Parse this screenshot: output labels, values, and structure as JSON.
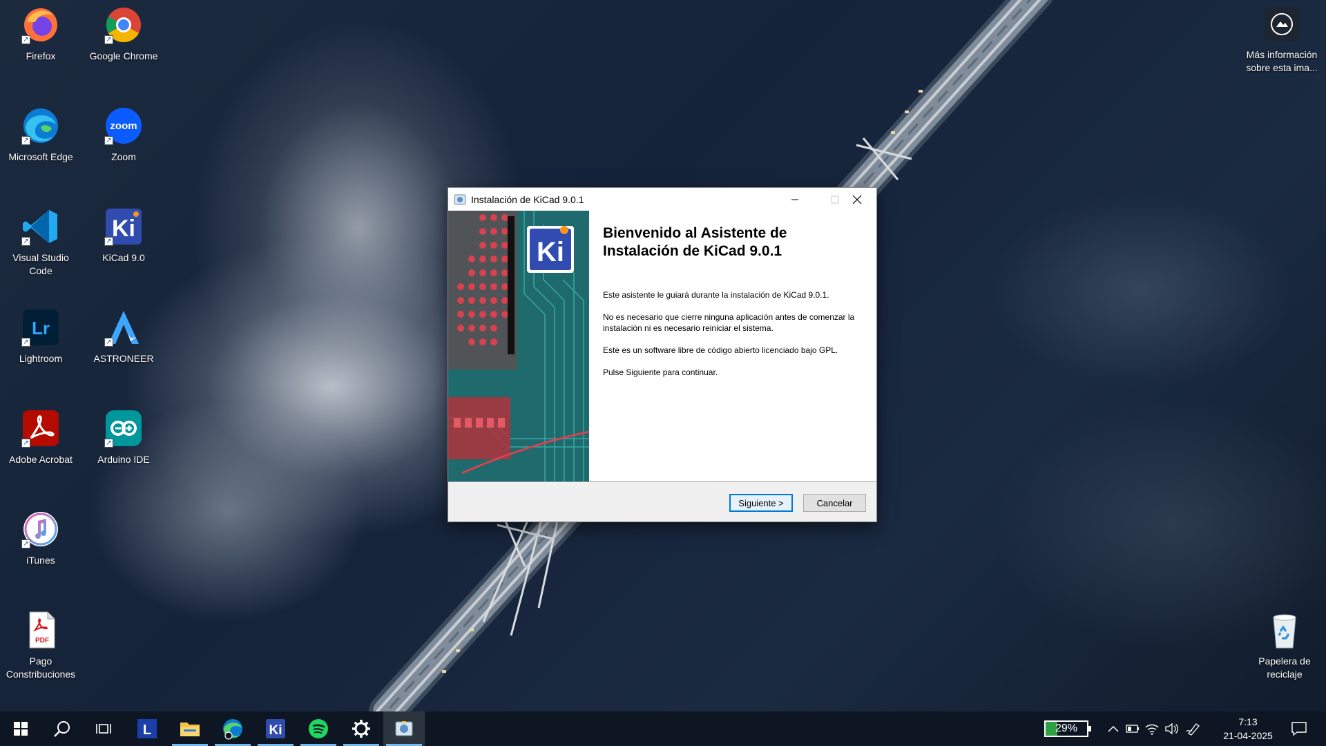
{
  "desktop": {
    "icons": [
      {
        "label": "Firefox"
      },
      {
        "label": "Google Chrome"
      },
      {
        "label": "Microsoft Edge"
      },
      {
        "label": "Zoom"
      },
      {
        "label": "Visual Studio Code"
      },
      {
        "label": "KiCad 9.0"
      },
      {
        "label": "Lightroom"
      },
      {
        "label": "ASTRONEER"
      },
      {
        "label": "Adobe Acrobat"
      },
      {
        "label": "Arduino IDE"
      },
      {
        "label": "iTunes"
      },
      {
        "label": "Pago Constribuciones"
      }
    ],
    "info_label": "Más información sobre esta ima...",
    "recycle_label": "Papelera de reciclaje"
  },
  "installer": {
    "title": "Instalación de KiCad 9.0.1",
    "heading": "Bienvenido al Asistente de Instalación de KiCad 9.0.1",
    "paragraphs": [
      "Este asistente le guiará durante la instalación de KiCad 9.0.1.",
      "No es necesario que cierre ninguna aplicación antes de comenzar la instalación ni es necesario reiniciar el sistema.",
      "Este es un software libre de código abierto licenciado bajo GPL.",
      "Pulse Siguiente para continuar."
    ],
    "next_label": "Siguiente >",
    "cancel_label": "Cancelar",
    "logo_text": "Ki"
  },
  "taskbar": {
    "battery_percent": "29%",
    "battery_fraction": 0.29,
    "time": "7:13",
    "date": "21-04-2025",
    "apps": [
      "windows-start",
      "search",
      "task-view",
      "lenovo-vantage",
      "file-explorer",
      "edge-beta",
      "kicad",
      "spotify",
      "settings",
      "kicad-installer"
    ]
  },
  "colors": {
    "accent": "#0078d7",
    "taskbar": "#0d1622",
    "battery": "#2ea043"
  }
}
